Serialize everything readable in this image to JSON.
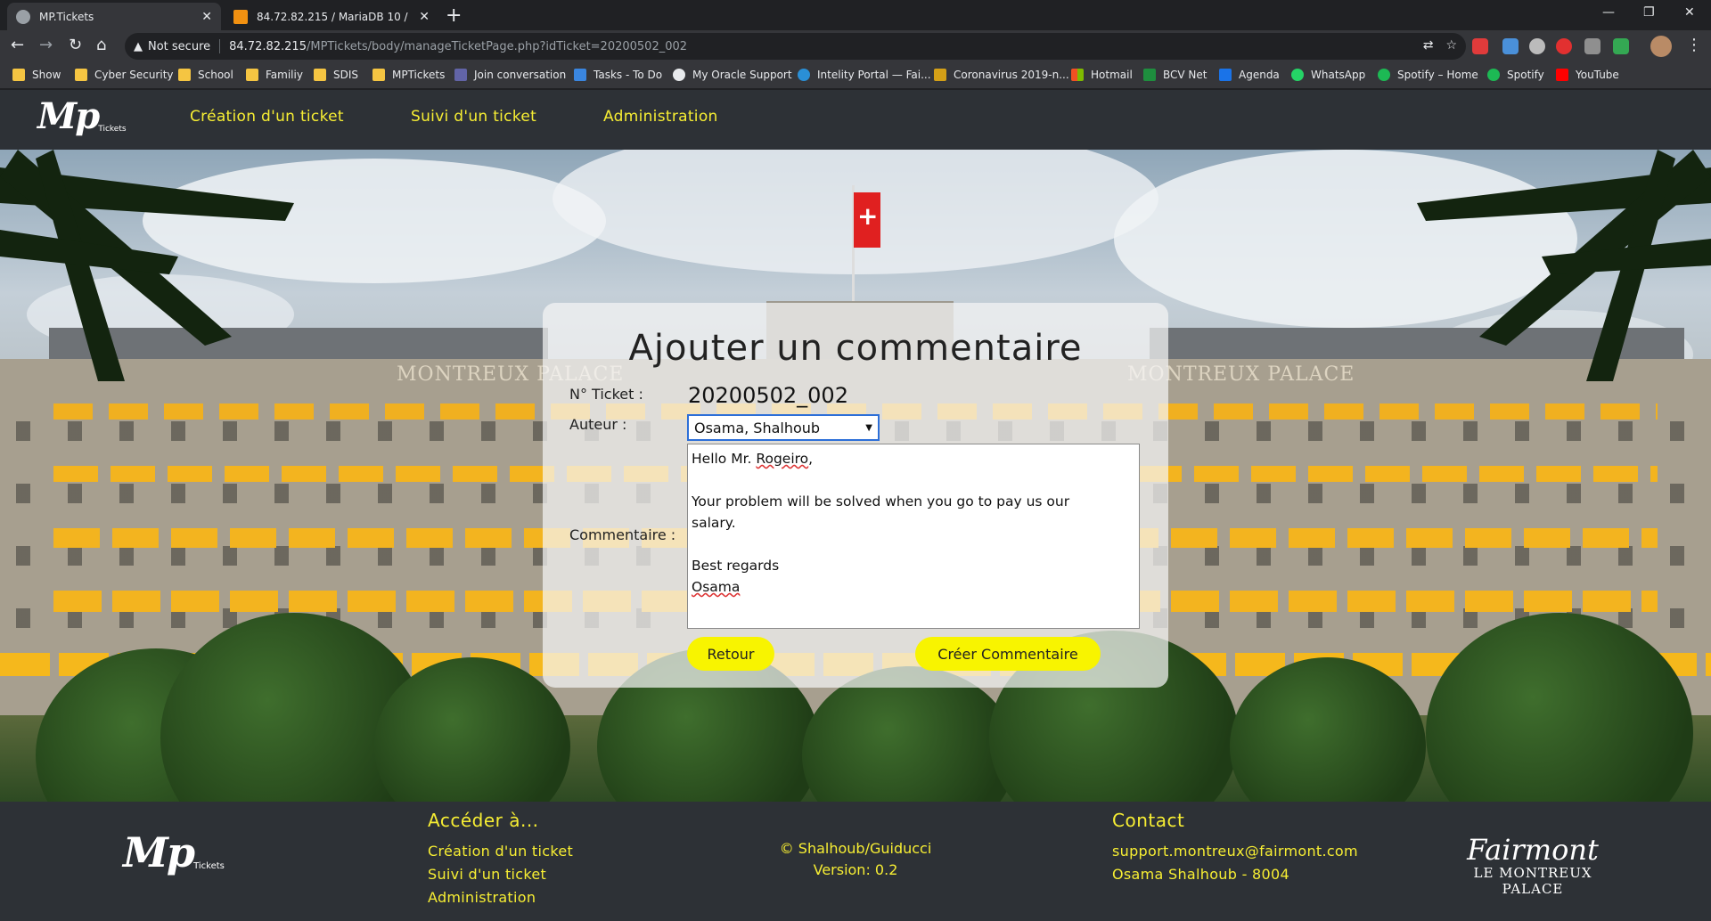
{
  "browser": {
    "tabs": [
      {
        "title": "MP.Tickets",
        "favicon_color": "#9aa0a6",
        "active": true
      },
      {
        "title": "84.72.82.215 / MariaDB 10 / MPT",
        "favicon_color": "#f29111",
        "active": false
      }
    ],
    "address": {
      "security_label": "Not secure",
      "host": "84.72.82.215",
      "path": "/MPTickets/body/manageTicketPage.php?idTicket=20200502_002"
    },
    "bookmarks": [
      {
        "label": "Show",
        "icon_color": "#f5c542"
      },
      {
        "label": "Cyber Security",
        "icon_color": "#f5c542"
      },
      {
        "label": "School",
        "icon_color": "#f5c542"
      },
      {
        "label": "Familiy",
        "icon_color": "#f5c542"
      },
      {
        "label": "SDIS",
        "icon_color": "#f5c542"
      },
      {
        "label": "MPTickets",
        "icon_color": "#f5c542"
      },
      {
        "label": "Join conversation",
        "icon_color": "#6264a7"
      },
      {
        "label": "Tasks - To Do",
        "icon_color": "#3a86e0"
      },
      {
        "label": "My Oracle Support",
        "icon_color": "#e8eaed"
      },
      {
        "label": "Intelity Portal — Fai...",
        "icon_color": "#2a8fd6"
      },
      {
        "label": "Coronavirus 2019-n...",
        "icon_color": "#d4a017"
      },
      {
        "label": "Hotmail",
        "icon_color": "#f25022"
      },
      {
        "label": "BCV Net",
        "icon_color": "#1e8e3e"
      },
      {
        "label": "Agenda",
        "icon_color": "#1a73e8"
      },
      {
        "label": "WhatsApp",
        "icon_color": "#25d366"
      },
      {
        "label": "Spotify – Home",
        "icon_color": "#1db954"
      },
      {
        "label": "Spotify",
        "icon_color": "#1db954"
      },
      {
        "label": "YouTube",
        "icon_color": "#ff0000"
      }
    ]
  },
  "site": {
    "logo": {
      "main": "Mp",
      "sub": "Tickets"
    },
    "nav": [
      {
        "label": "Création d'un ticket"
      },
      {
        "label": "Suivi d'un ticket"
      },
      {
        "label": "Administration"
      }
    ],
    "hero": {
      "left_sign": "MONTREUX PALACE",
      "right_sign": "MONTREUX PALACE"
    },
    "form": {
      "title": "Ajouter un commentaire",
      "ticket_label": "N° Ticket :",
      "ticket_value": "20200502_002",
      "author_label": "Auteur :",
      "author_value": "Osama, Shalhoub",
      "comment_label": "Commentaire :",
      "comment_lines": {
        "greeting_prefix": "Hello Mr. ",
        "greeting_name": "Rogeiro",
        "greeting_suffix": ",",
        "line2": "Your problem will be solved when you go to pay us our",
        "line3": "salary.",
        "line4": "Best regards",
        "signature": "Osama"
      },
      "back_button": "Retour",
      "submit_button": "Créer Commentaire"
    },
    "footer": {
      "access_heading": "Accéder à...",
      "links": [
        "Création d'un ticket",
        "Suivi d'un ticket",
        "Administration"
      ],
      "copyright": "© Shalhoub/Guiducci",
      "version": "Version: 0.2",
      "contact_heading": "Contact",
      "email": "support.montreux@fairmont.com",
      "phone_line": "Osama Shalhoub - 8004",
      "brand_script": "Fairmont",
      "brand_name": "LE MONTREUX PALACE"
    },
    "colors": {
      "accent": "#f7ee33",
      "header_bg": "#2d3136",
      "button_bg": "#f8f400"
    }
  }
}
